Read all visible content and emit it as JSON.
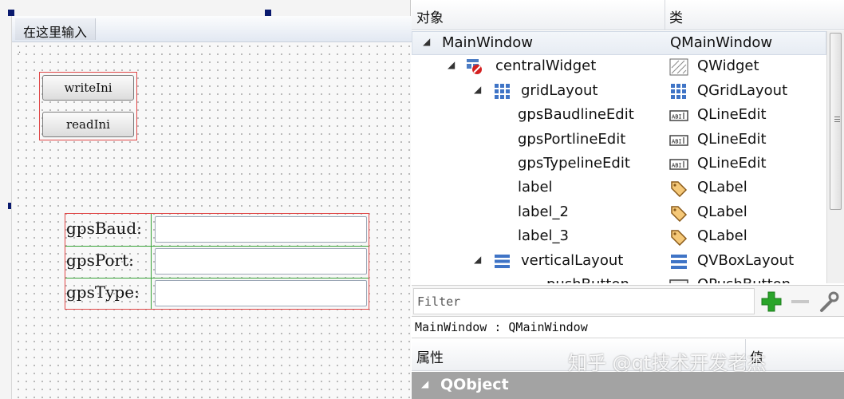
{
  "form": {
    "menu_placeholder": "在这里输入",
    "buttons": [
      {
        "label": "writeIni"
      },
      {
        "label": "readIni"
      }
    ],
    "grid_rows": [
      {
        "label": "gpsBaud:"
      },
      {
        "label": "gpsPort:"
      },
      {
        "label": "gpsType:"
      }
    ]
  },
  "inspector": {
    "header": {
      "object_col": "对象",
      "class_col": "类"
    },
    "tree": [
      {
        "name": "MainWindow",
        "class": "QMainWindow",
        "expanded": true,
        "class_icon": "none",
        "object_icon": "none"
      },
      {
        "name": "centralWidget",
        "class": "QWidget",
        "expanded": true,
        "class_icon": "widget-icon",
        "object_icon": "broken-layout-icon"
      },
      {
        "name": "gridLayout",
        "class": "QGridLayout",
        "expanded": true,
        "class_icon": "grid-layout-icon",
        "object_icon": "grid-layout-icon"
      },
      {
        "name": "gpsBaudlineEdit",
        "class": "QLineEdit",
        "class_icon": "line-edit-icon"
      },
      {
        "name": "gpsPortlineEdit",
        "class": "QLineEdit",
        "class_icon": "line-edit-icon"
      },
      {
        "name": "gpsTypelineEdit",
        "class": "QLineEdit",
        "class_icon": "line-edit-icon"
      },
      {
        "name": "label",
        "class": "QLabel",
        "class_icon": "label-tag-icon"
      },
      {
        "name": "label_2",
        "class": "QLabel",
        "class_icon": "label-tag-icon"
      },
      {
        "name": "label_3",
        "class": "QLabel",
        "class_icon": "label-tag-icon"
      },
      {
        "name": "verticalLayout",
        "class": "QVBoxLayout",
        "expanded": true,
        "class_icon": "vbox-layout-icon",
        "object_icon": "vbox-layout-icon"
      },
      {
        "name": "pushButton",
        "class": "QPushButton",
        "class_icon": "push-button-icon"
      }
    ],
    "filter": {
      "placeholder": "Filter"
    },
    "selected_path": "MainWindow : QMainWindow",
    "properties_header": {
      "property_col": "属性",
      "value_col": "值"
    },
    "watermark": "知乎 @qt技术开发老杰",
    "first_group": "QObject"
  },
  "colors": {
    "selection_red": "#e04848",
    "layout_green": "#36a336",
    "handle_navy": "#0a1a6e",
    "group_row_gray": "#a3a3a3",
    "add_green": "#2aa52a"
  }
}
